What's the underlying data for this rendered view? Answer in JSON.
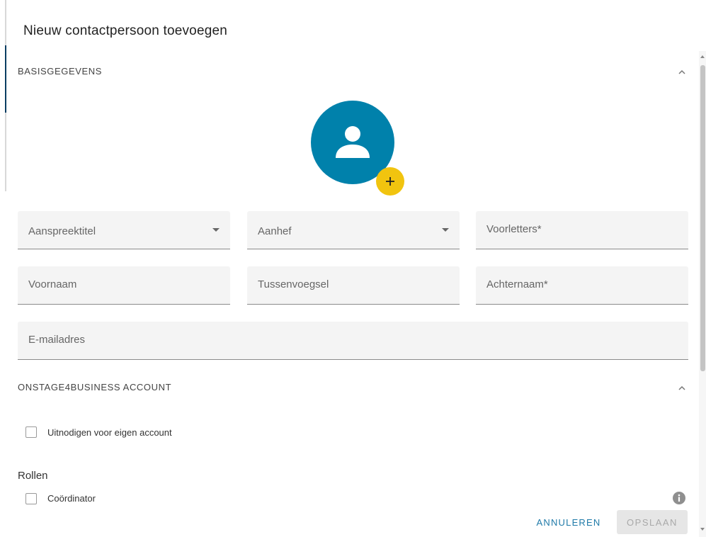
{
  "dialog": {
    "title": "Nieuw contactpersoon toevoegen"
  },
  "sections": {
    "basic": {
      "title": "BASISGEGEVENS"
    },
    "account": {
      "title": "ONSTAGE4BUSINESS ACCOUNT"
    }
  },
  "fields": {
    "salutation_title": {
      "placeholder": "Aanspreektitel"
    },
    "salutation": {
      "placeholder": "Aanhef"
    },
    "initials": {
      "placeholder": "Voorletters*"
    },
    "first_name": {
      "placeholder": "Voornaam"
    },
    "infix": {
      "placeholder": "Tussenvoegsel"
    },
    "last_name": {
      "placeholder": "Achternaam*"
    },
    "email": {
      "placeholder": "E-mailadres"
    }
  },
  "account": {
    "invite_label": "Uitnodigen voor eigen account"
  },
  "roles": {
    "title": "Rollen",
    "items": [
      {
        "label": "Coördinator"
      }
    ]
  },
  "actions": {
    "cancel": "ANNULEREN",
    "save": "OPSLAAN"
  },
  "colors": {
    "avatar": "#0081ab",
    "add_photo": "#f1c40f",
    "primary_text": "#1f7aa8"
  },
  "icons": {
    "avatar": "person-icon",
    "add_photo": "plus-icon",
    "collapse": "chevron-up-icon",
    "dropdown": "caret-down-icon",
    "info": "info-icon"
  }
}
